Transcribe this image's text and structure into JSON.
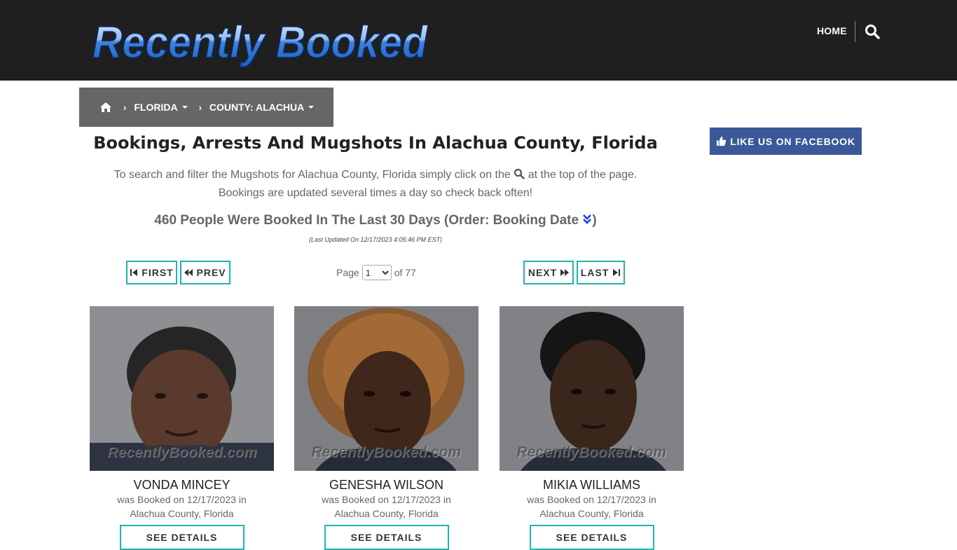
{
  "header": {
    "logo_text": "Recently Booked",
    "nav_home": "HOME"
  },
  "breadcrumb": {
    "state": "FLORIDA",
    "county": "COUNTY: ALACHUA"
  },
  "main": {
    "title": "Bookings, Arrests And Mugshots In Alachua County, Florida",
    "intro_before_icon": "To search and filter the Mugshots for Alachua County, Florida simply click on the",
    "intro_after_icon": "at the top of the page.",
    "intro_line2": "Bookings are updated several times a day so check back often!",
    "count_text": "460 People Were Booked In The Last 30 Days (Order: Booking Date",
    "count_close": ")",
    "updated": "(Last Updated On 12/17/2023 4:05:46 PM EST)"
  },
  "pagination": {
    "first": "FIRST",
    "prev": "PREV",
    "next": "NEXT",
    "last": "LAST",
    "page_label": "Page",
    "current_page": "1",
    "of_label": "of 77"
  },
  "cards": [
    {
      "name": "VONDA MINCEY",
      "line1": "was Booked on 12/17/2023 in",
      "line2": "Alachua County, Florida",
      "button": "SEE DETAILS",
      "watermark": "RecentlyBooked.com"
    },
    {
      "name": "GENESHA WILSON",
      "line1": "was Booked on 12/17/2023 in",
      "line2": "Alachua County, Florida",
      "button": "SEE DETAILS",
      "watermark": "RecentlyBooked.com"
    },
    {
      "name": "MIKIA WILLIAMS",
      "line1": "was Booked on 12/17/2023 in",
      "line2": "Alachua County, Florida",
      "button": "SEE DETAILS",
      "watermark": "RecentlyBooked.com"
    }
  ],
  "sidebar": {
    "facebook": "LIKE US ON FACEBOOK"
  },
  "colors": {
    "header_bg": "#1f1f1f",
    "breadcrumb_bg": "#666666",
    "accent_teal": "#1fb5ad",
    "facebook_blue": "#3b5998",
    "logo_blue": "#4a8fe0"
  },
  "icons": [
    "search-icon",
    "home-icon",
    "chevron-right-icon",
    "caret-down-icon",
    "step-backward-icon",
    "backward-icon",
    "forward-icon",
    "step-forward-icon",
    "double-chevron-down-icon",
    "thumbs-up-icon"
  ]
}
